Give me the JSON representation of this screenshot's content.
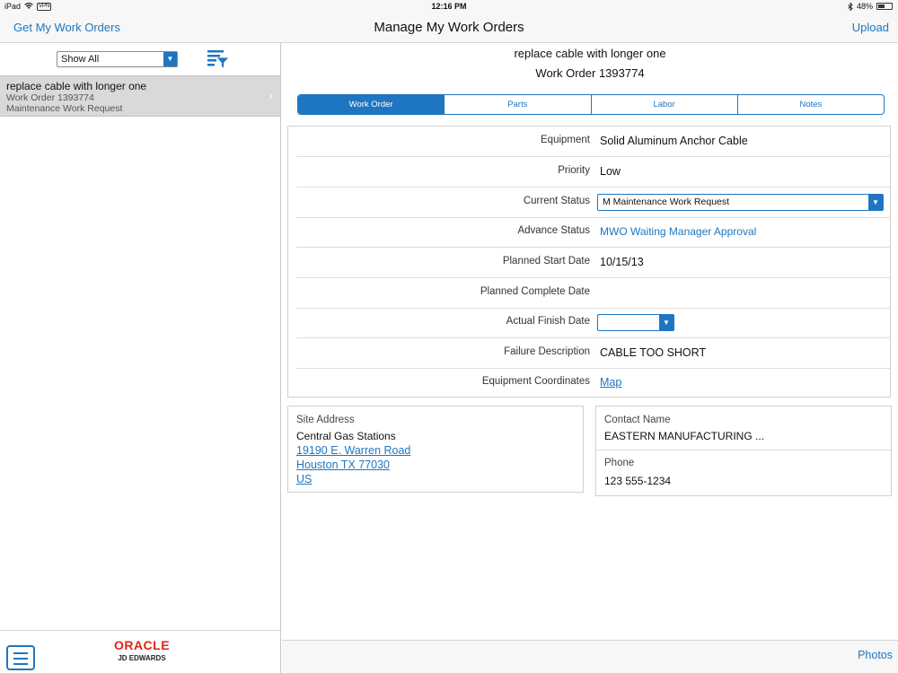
{
  "status_bar": {
    "device": "iPad",
    "vpn": "VPN",
    "time": "12:16 PM",
    "battery": "48%"
  },
  "nav": {
    "left_label": "Get My Work Orders",
    "title": "Manage My Work Orders",
    "right_label": "Upload"
  },
  "left": {
    "filter_value": "Show All",
    "items": [
      {
        "title": "replace cable with longer one",
        "subtitle": "Work Order 1393774",
        "type": "Maintenance Work Request"
      }
    ],
    "logo_top": "ORACLE",
    "logo_bottom": "JD EDWARDS"
  },
  "detail": {
    "title": "replace cable with longer one",
    "subtitle": "Work Order 1393774",
    "tabs": [
      "Work Order",
      "Parts",
      "Labor",
      "Notes"
    ],
    "active_tab": 0,
    "fields": {
      "equipment": {
        "label": "Equipment",
        "value": "Solid Aluminum Anchor Cable"
      },
      "priority": {
        "label": "Priority",
        "value": "Low"
      },
      "current_status": {
        "label": "Current Status",
        "value": "M Maintenance Work Request"
      },
      "advance_status": {
        "label": "Advance Status",
        "value": "MWO Waiting Manager Approval"
      },
      "planned_start": {
        "label": "Planned Start Date",
        "value": "10/15/13"
      },
      "planned_complete": {
        "label": "Planned Complete Date",
        "value": ""
      },
      "actual_finish": {
        "label": "Actual Finish Date",
        "value": ""
      },
      "failure_description": {
        "label": "Failure Description",
        "value": "CABLE TOO SHORT"
      },
      "equipment_coordinates": {
        "label": "Equipment Coordinates",
        "value": "Map"
      }
    },
    "site": {
      "label": "Site Address",
      "name": "Central Gas Stations",
      "street": "19190 E. Warren Road",
      "city": "Houston TX 77030",
      "country": "US"
    },
    "contact": {
      "name_label": "Contact Name",
      "name": "EASTERN MANUFACTURING ...",
      "phone_label": "Phone",
      "phone": "123 555-1234"
    },
    "footer_label": "Photos"
  },
  "colors": {
    "accent": "#1e76c2",
    "selected_row": "#d9d9d9",
    "oracle_red": "#e2231a"
  }
}
